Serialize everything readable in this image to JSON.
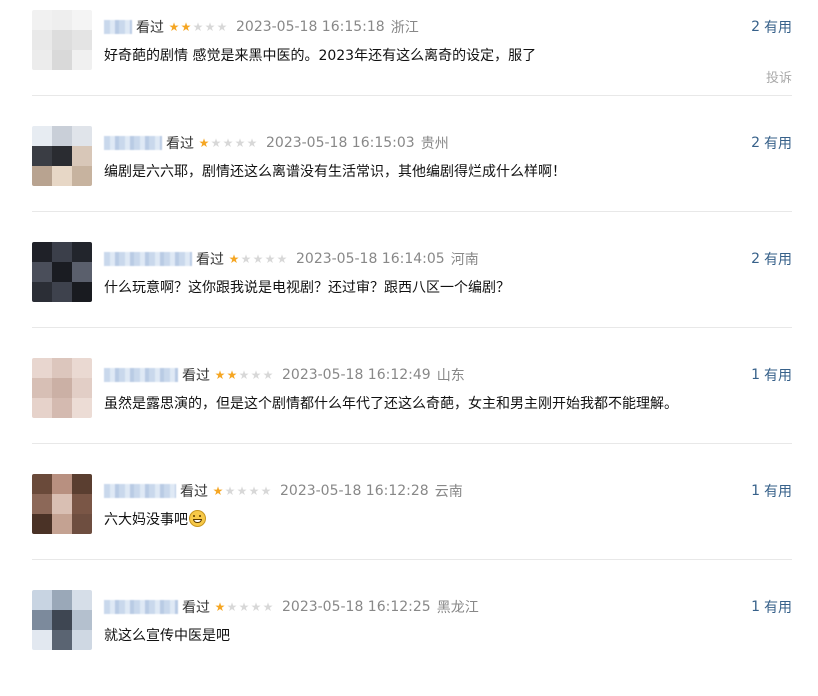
{
  "colors": {
    "star_on": "#f5a623",
    "star_off": "#d8d8d8",
    "link": "#37618a",
    "meta_gray": "#888888",
    "divider": "#e8e8e8"
  },
  "useful_label": "有用",
  "report_label": "投诉",
  "watched_label": "看过",
  "comments": [
    {
      "avatar": [
        "#f1f1f1",
        "#eeeeee",
        "#f4f4f4",
        "#e9e9e9",
        "#dddddd",
        "#e4e4e4",
        "#ececec",
        "#d9d9d9",
        "#f0f0f0"
      ],
      "rating": 2,
      "time": "2023-05-18 16:15:18",
      "region": "浙江",
      "content": "好奇葩的剧情 感觉是来黑中医的。2023年还有这么离奇的设定，服了",
      "useful_count": "2",
      "show_report": true,
      "name_blur_width": 28
    },
    {
      "avatar": [
        "#e7ecf2",
        "#c9cfd8",
        "#e0e4ea",
        "#3a3d44",
        "#2a2c31",
        "#d8c7b8",
        "#b8a390",
        "#e7d7c6",
        "#c7b39f"
      ],
      "rating": 1,
      "time": "2023-05-18 16:15:03",
      "region": "贵州",
      "content": "编剧是六六耶，剧情还这么离谱没有生活常识，其他编剧得烂成什么样啊！",
      "useful_count": "2",
      "show_report": false,
      "name_blur_width": 58
    },
    {
      "avatar": [
        "#1f2128",
        "#3b3f4a",
        "#22252c",
        "#4a4e5a",
        "#1a1c22",
        "#5a5f6c",
        "#2b2e36",
        "#3e424d",
        "#191b20"
      ],
      "rating": 1,
      "time": "2023-05-18 16:14:05",
      "region": "河南",
      "content": "什么玩意啊？这你跟我说是电视剧？还过审？跟西八区一个编剧？",
      "useful_count": "2",
      "show_report": false,
      "name_blur_width": 88
    },
    {
      "avatar": [
        "#e8d6cf",
        "#dcc6bd",
        "#ead9d2",
        "#d7bfb5",
        "#cbb0a5",
        "#e2cec6",
        "#e6d2ca",
        "#d4bab0",
        "#ecdcd5"
      ],
      "rating": 2,
      "time": "2023-05-18 16:12:49",
      "region": "山东",
      "content": "虽然是露思演的，但是这个剧情都什么年代了还这么奇葩，女主和男主刚开始我都不能理解。",
      "useful_count": "1",
      "show_report": false,
      "name_blur_width": 74
    },
    {
      "avatar": [
        "#6a4a3a",
        "#b89080",
        "#5a3e30",
        "#8c6858",
        "#d9bfb3",
        "#7a5646",
        "#4a3226",
        "#c4a292",
        "#6e4e40"
      ],
      "rating": 1,
      "time": "2023-05-18 16:12:28",
      "region": "云南",
      "content": "六大妈没事吧",
      "useful_count": "1",
      "show_report": false,
      "name_blur_width": 72,
      "emoji_after": true
    },
    {
      "avatar": [
        "#c8d4e2",
        "#9aa8b8",
        "#d6dee8",
        "#7c8a9c",
        "#3e4652",
        "#b4c0ce",
        "#e2e8f0",
        "#5a6472",
        "#cfd8e3"
      ],
      "rating": 1,
      "time": "2023-05-18 16:12:25",
      "region": "黑龙江",
      "content": "就这么宣传中医是吧",
      "useful_count": "1",
      "show_report": false,
      "name_blur_width": 74
    }
  ]
}
